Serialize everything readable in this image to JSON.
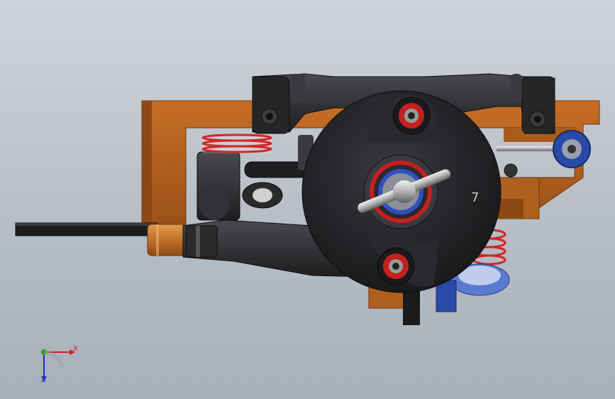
{
  "viewport": {
    "background_top": "#cfd3d9",
    "background_bottom": "#a9b0b9"
  },
  "colors": {
    "chassis": "#b4621e",
    "chassis_dark": "#7a3c0e",
    "arm": "#2c2c2e",
    "arm_light": "#4a4a4e",
    "spring": "#d02828",
    "bearing_red": "#c42020",
    "bearing_blue": "#3050c0",
    "anodized_blue": "#2a4aa8",
    "brass": "#c87a30"
  },
  "triad": {
    "x_label": "X",
    "z_label": "Z",
    "x_color": "#d02020",
    "y_color": "#20a020",
    "z_color": "#2030c0"
  },
  "part_mark": "7"
}
